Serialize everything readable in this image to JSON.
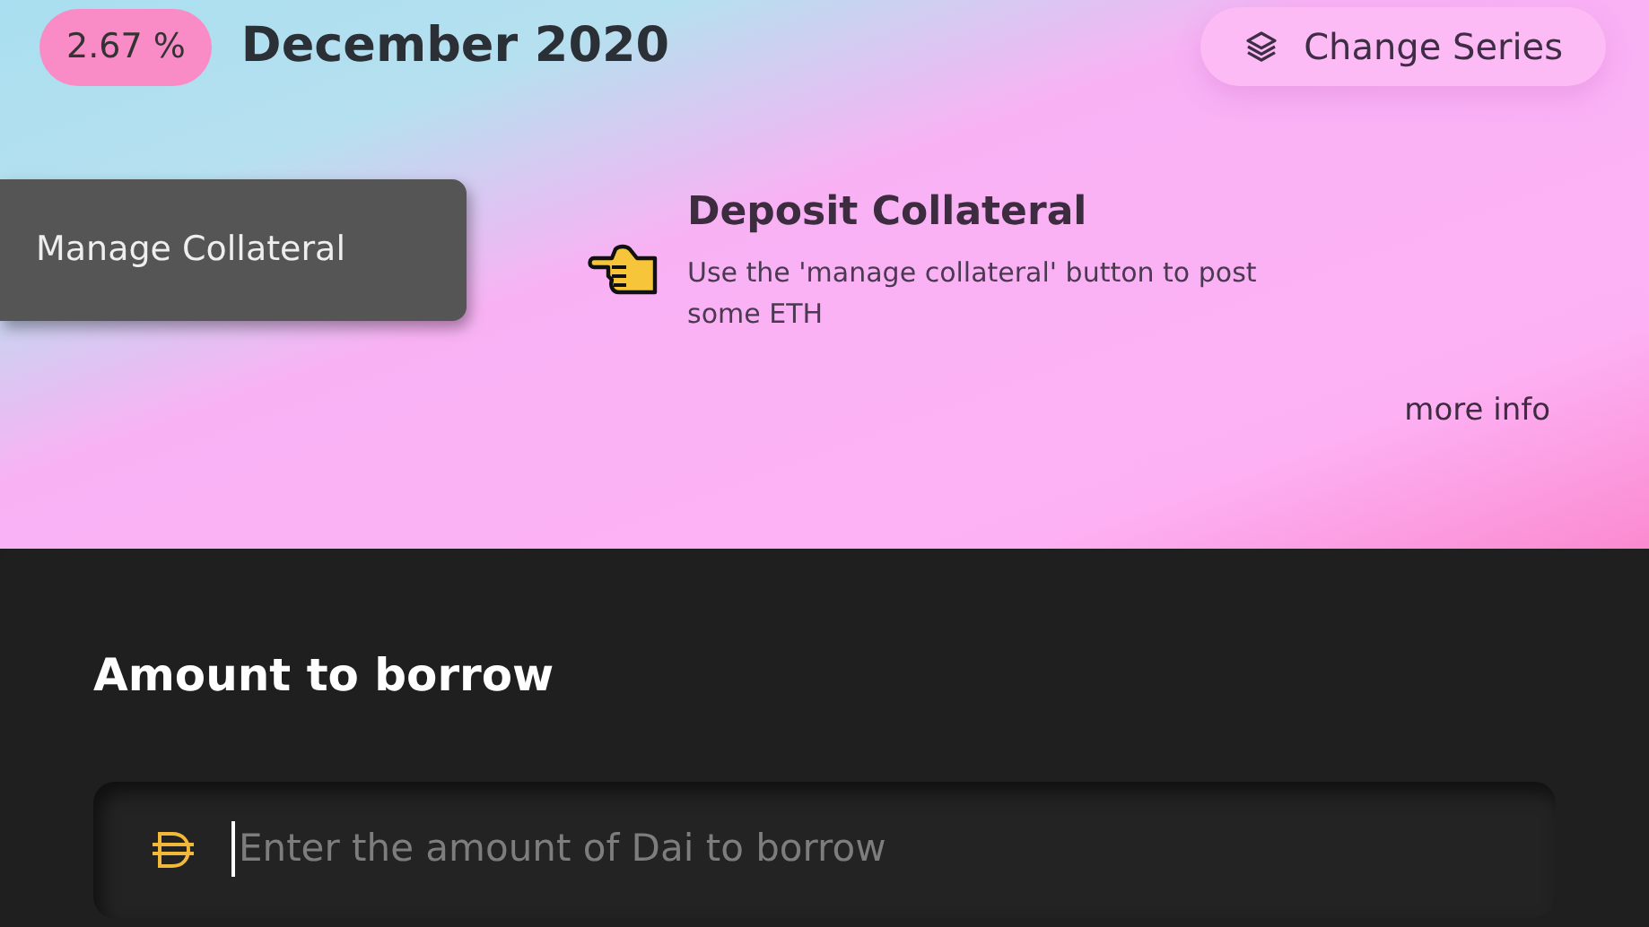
{
  "header": {
    "rate": "2.67 %",
    "series": "December 2020",
    "change_series_button": "Change Series"
  },
  "manage_button": "Manage Collateral",
  "notice": {
    "title": "Deposit Collateral",
    "body": "Use the 'manage collateral' button to post some ETH",
    "link": "more info"
  },
  "borrow": {
    "heading": "Amount to borrow",
    "input": {
      "placeholder": "Enter the amount of Dai to borrow"
    }
  }
}
